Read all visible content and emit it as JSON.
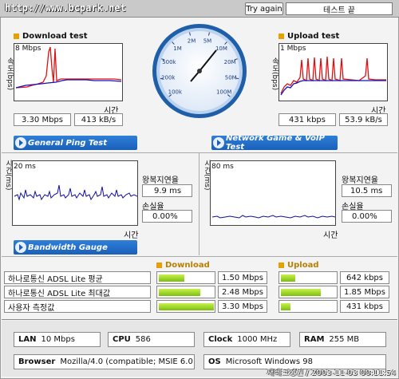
{
  "header": {
    "url": "http://www.bcpark.net",
    "try_again": "Try again",
    "test_end": "테스트 끝"
  },
  "download": {
    "title": "Download test",
    "ylabel": "속도(bps)",
    "scale": "8 Mbps",
    "xlabel": "시간",
    "speed": "3.30 Mbps",
    "kbps": "413 kB/s"
  },
  "upload": {
    "title": "Upload test",
    "ylabel": "속도(bps)",
    "scale": "1 Mbps",
    "xlabel": "시간",
    "speed": "431 kbps",
    "kbps": "53.9 kB/s"
  },
  "gauge": {
    "ticks": [
      "100k",
      "200k",
      "500k",
      "1M",
      "2M",
      "5M",
      "10M",
      "20M",
      "50M",
      "100M"
    ]
  },
  "ping": {
    "banner": "General Ping Test",
    "ylabel": "시간(ms)",
    "scale": "20 ms",
    "xlabel": "시간",
    "rtt_label": "왕복지연율",
    "rtt": "9.9 ms",
    "loss_label": "손실율",
    "loss": "0.00%"
  },
  "game": {
    "banner": "Network Game & VoIP Test",
    "ylabel": "시간(ms)",
    "scale": "80 ms",
    "xlabel": "시간",
    "rtt_label": "왕복지연율",
    "rtt": "10.5 ms",
    "loss_label": "손실율",
    "loss": "0.00%"
  },
  "bandwidth": {
    "banner": "Bandwidth Gauge",
    "download_header": "Download",
    "upload_header": "Upload",
    "rows": [
      {
        "label": "하나로통신 ADSL Lite 평균",
        "down": "1.50 Mbps",
        "down_fill": 0.45,
        "up": "642 kbps",
        "up_fill": 0.25
      },
      {
        "label": "하나로통신 ADSL Lite 최대값",
        "down": "2.48 Mbps",
        "down_fill": 0.74,
        "up": "1.85 Mbps",
        "up_fill": 0.72
      },
      {
        "label": "사용자 측정값",
        "down": "3.30 Mbps",
        "down_fill": 0.98,
        "up": "431 kbps",
        "up_fill": 0.17
      }
    ]
  },
  "info": {
    "lan_label": "LAN",
    "lan": "10 Mbps",
    "cpu_label": "CPU",
    "cpu": "586",
    "clock_label": "Clock",
    "clock": "1000 MHz",
    "ram_label": "RAM",
    "ram": "255 MB",
    "browser_label": "Browser",
    "browser": "Mozilla/4.0 (compatible; MSIE 6.0",
    "os_label": "OS",
    "os": "Microsoft Windows 98"
  },
  "footer": "재테크정원 / 2003-11-03 00:11:54",
  "colors": {
    "accent": "#1a5fb8",
    "red": "#e01010",
    "blue": "#1010c0",
    "bar": "#9ad61e",
    "orange": "#e8a000"
  }
}
